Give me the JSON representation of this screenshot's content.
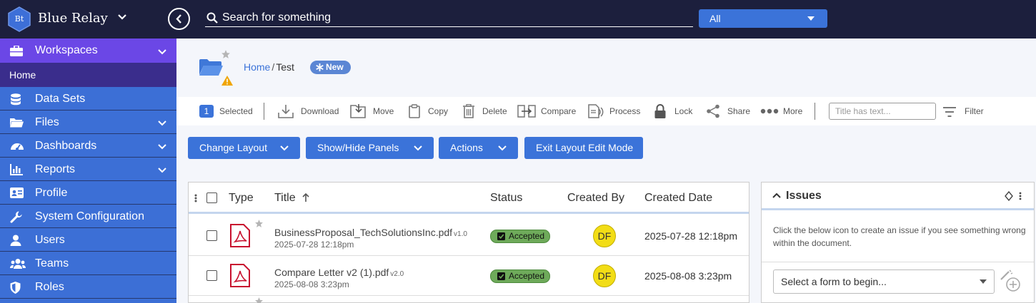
{
  "app": {
    "logo_text": "Bt",
    "title": "Blue Relay"
  },
  "search": {
    "placeholder": "Search for something",
    "scope": "All"
  },
  "sidebar": {
    "workspaces": "Workspaces",
    "home": "Home",
    "items": [
      {
        "label": "Data Sets",
        "icon": "database-icon"
      },
      {
        "label": "Files",
        "icon": "folder-icon"
      },
      {
        "label": "Dashboards",
        "icon": "gauge-icon"
      },
      {
        "label": "Reports",
        "icon": "bar-chart-icon"
      },
      {
        "label": "Profile",
        "icon": "id-card-icon"
      },
      {
        "label": "System Configuration",
        "icon": "wrench-icon"
      },
      {
        "label": "Users",
        "icon": "user-icon"
      },
      {
        "label": "Teams",
        "icon": "users-icon"
      },
      {
        "label": "Roles",
        "icon": "shield-icon"
      }
    ]
  },
  "breadcrumb": {
    "home": "Home",
    "separator": "/",
    "current": "Test",
    "badge": "New"
  },
  "toolbar": {
    "selected_count": "1",
    "selected": "Selected",
    "download": "Download",
    "move": "Move",
    "copy": "Copy",
    "delete": "Delete",
    "compare": "Compare",
    "process": "Process",
    "lock": "Lock",
    "share": "Share",
    "more": "More",
    "filter_placeholder": "Title has text...",
    "filter": "Filter"
  },
  "layout_buttons": {
    "change_layout": "Change Layout",
    "show_hide": "Show/Hide Panels",
    "actions": "Actions",
    "exit": "Exit Layout Edit Mode"
  },
  "table": {
    "columns": {
      "type": "Type",
      "title": "Title",
      "status": "Status",
      "created_by": "Created By",
      "created_date": "Created Date"
    },
    "rows": [
      {
        "title": "BusinessProposal_TechSolutionsInc.pdf",
        "version": "v1.0",
        "date": "2025-07-28 12:18pm",
        "status": "Accepted",
        "created_by": "DF",
        "created_date": "2025-07-28 12:18pm"
      },
      {
        "title": "Compare Letter v2 (1).pdf",
        "version": "v2.0",
        "date": "2025-08-08 3:23pm",
        "status": "Accepted",
        "created_by": "DF",
        "created_date": "2025-08-08 3:23pm"
      }
    ]
  },
  "issues": {
    "title": "Issues",
    "description": "Click the below icon to create an issue if you see something wrong within the document.",
    "form_placeholder": "Select a form to begin..."
  },
  "colors": {
    "topbar": "#1c1f3d",
    "sidebar": "#3c6fd6",
    "accent": "#3b73d9",
    "workspace": "#6b47e6",
    "accepted": "#6eaa5a"
  }
}
